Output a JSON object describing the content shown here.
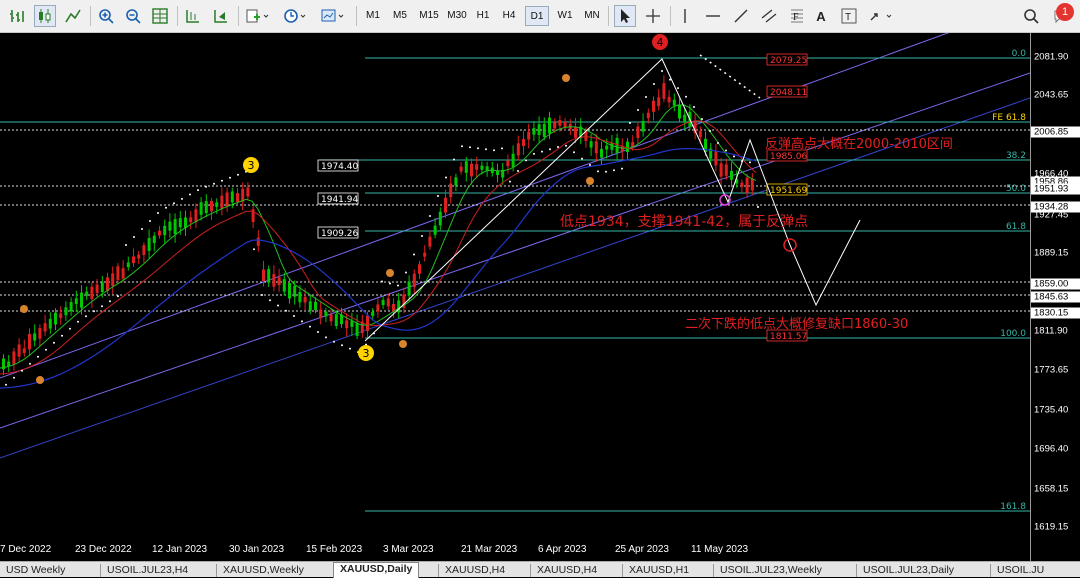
{
  "toolbar": {
    "timeframes": [
      "M1",
      "M5",
      "M15",
      "M30",
      "H1",
      "H4",
      "D1",
      "W1",
      "MN"
    ],
    "active_timeframe": "D1",
    "letter_tool": "A",
    "notification_count": "1"
  },
  "price_axis": {
    "ticks": [
      "2081.90",
      "2043.65",
      "2006.85",
      "1966.40",
      "1927.45",
      "1889.15",
      "1850.00",
      "1811.90",
      "1773.65",
      "1735.40",
      "1696.40",
      "1658.15",
      "1619.15"
    ],
    "tags": [
      {
        "label": "2006.85"
      },
      {
        "label": "1958.86"
      },
      {
        "label": "1951.93"
      },
      {
        "label": "1934.28"
      },
      {
        "label": "1859.00"
      },
      {
        "label": "1845.63"
      },
      {
        "label": "1830.15"
      }
    ]
  },
  "date_axis": [
    "7 Dec 2022",
    "23 Dec 2022",
    "12 Jan 2023",
    "30 Jan 2023",
    "15 Feb 2023",
    "3 Mar 2023",
    "21 Mar 2023",
    "6 Apr 2023",
    "25 Apr 2023",
    "11 May 2023"
  ],
  "fib_levels": [
    {
      "label": "0.0"
    },
    {
      "label": "FE 61.8"
    },
    {
      "label": "38.2"
    },
    {
      "label": "50.0"
    },
    {
      "label": "61.8"
    },
    {
      "label": "100.0"
    },
    {
      "label": "161.8"
    }
  ],
  "level_tags": [
    {
      "label": "2079.25",
      "color": "#ff3333"
    },
    {
      "label": "2048.11",
      "color": "#ff3333"
    },
    {
      "label": "1985.06",
      "color": "#ff3333"
    },
    {
      "label": "1951.69",
      "color": "#ffcc00"
    },
    {
      "label": "1811.57",
      "color": "#ff3333"
    },
    {
      "label": "1974.40",
      "color": "#ffffff"
    },
    {
      "label": "1941.94",
      "color": "#ffffff"
    },
    {
      "label": "1909.26",
      "color": "#ffffff"
    }
  ],
  "wave_labels": [
    {
      "label": "4",
      "style": "red"
    },
    {
      "label": "3",
      "style": "yellow"
    },
    {
      "label": "3",
      "style": "yellow"
    }
  ],
  "annotations": [
    {
      "text": "反弹高点大概在2000-2010区间"
    },
    {
      "text": "低点1934，支撑1941-42，属于反弹点"
    },
    {
      "text": "二次下跌的低点大概修复缺口1860-30"
    }
  ],
  "tabs": [
    "USD Weekly",
    "USOIL.JUL23,H4",
    "XAUUSD,Weekly",
    "XAUUSD,Daily",
    "XAUUSD,H4",
    "XAUUSD,H4",
    "XAUUSD,H1",
    "USOIL.JUL23,Weekly",
    "USOIL.JUL23,Daily",
    "USOIL.JU"
  ],
  "active_tab": "XAUUSD,Daily",
  "colors": {
    "background": "#000000",
    "annotation": "#e02020",
    "fib": "#35b8a8",
    "channel": "#7b68ee",
    "bull": "#00c800",
    "bear": "#e02020"
  }
}
